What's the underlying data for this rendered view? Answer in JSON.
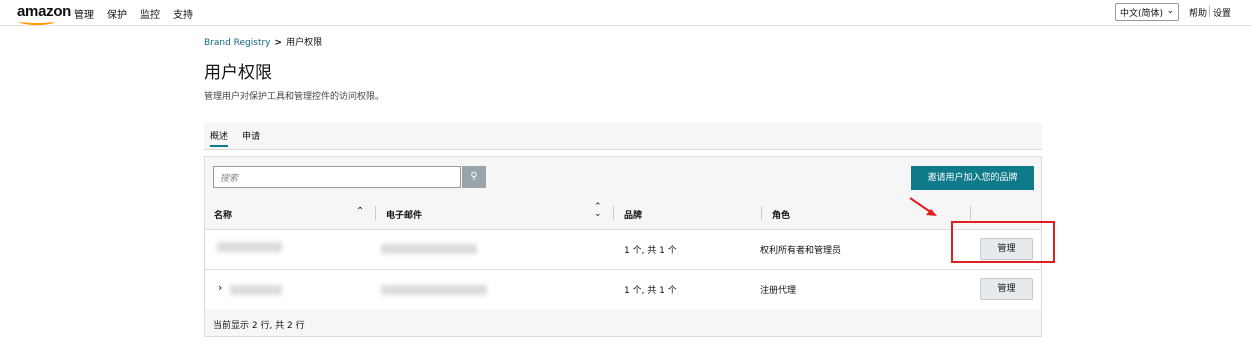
{
  "topbar": {
    "logo": "amazon",
    "nav": [
      "管理",
      "保护",
      "监控",
      "支持"
    ],
    "language": "中文(简体)",
    "help": "帮助",
    "settings": "设置"
  },
  "breadcrumb": {
    "root": "Brand Registry",
    "separator": ">",
    "current": "用户权限"
  },
  "page": {
    "title": "用户权限",
    "subtitle": "管理用户对保护工具和管理控件的访问权限。"
  },
  "tabs": [
    {
      "label": "概述",
      "active": true
    },
    {
      "label": "申请",
      "active": false
    }
  ],
  "search": {
    "placeholder": "搜索",
    "icon": "search-icon"
  },
  "invite_button": "邀请用户加入您的品牌",
  "table": {
    "headers": [
      "名称",
      "电子邮件",
      "品牌",
      "角色"
    ],
    "rows": [
      {
        "brands": "1 个, 共 1 个",
        "role": "权利所有者和管理员",
        "action": "管理",
        "expandable": false
      },
      {
        "brands": "1 个, 共 1 个",
        "role": "注册代理",
        "action": "管理",
        "expandable": true
      }
    ],
    "footer": "当前显示 2 行, 共 2 行"
  },
  "colors": {
    "accent": "#0f7a8a",
    "annotation": "#e02020",
    "logo_smile": "#ff9900"
  }
}
